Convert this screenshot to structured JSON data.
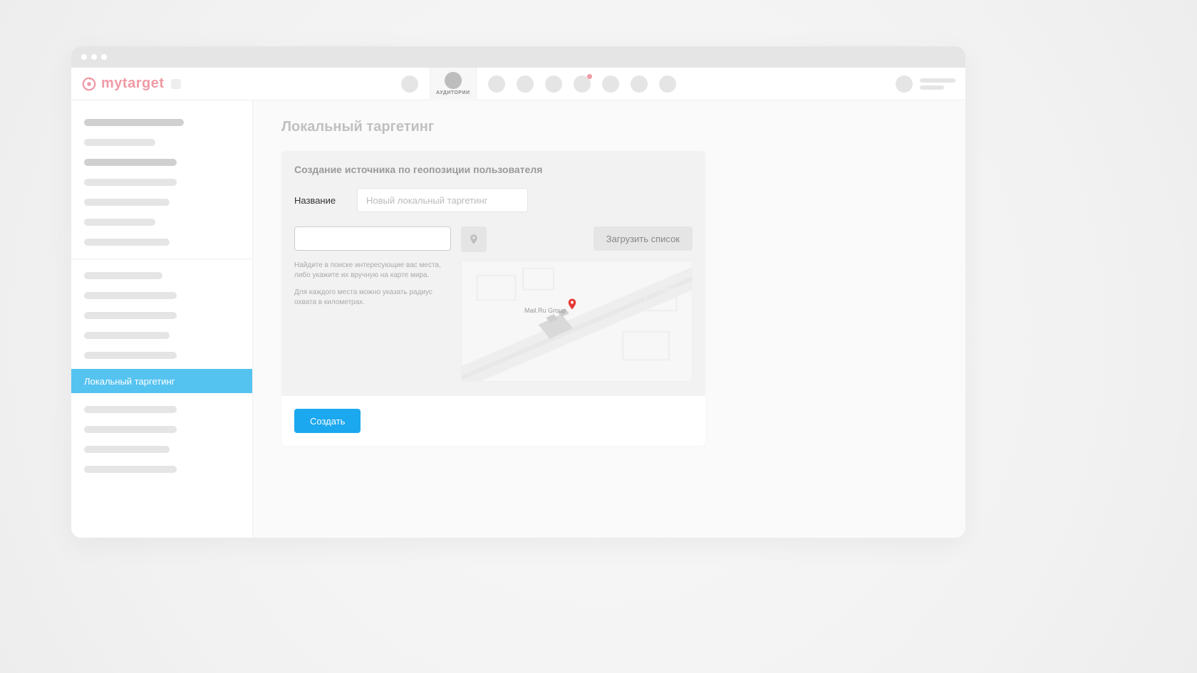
{
  "brand": {
    "name": "mytarget"
  },
  "topnav": {
    "active_tab_label": "АУДИТОРИИ"
  },
  "sidebar": {
    "active_item_label": "Локальный таргетинг"
  },
  "page": {
    "title": "Локальный таргетинг"
  },
  "panel": {
    "subtitle": "Создание источника по геопозиции пользователя",
    "name_label": "Название",
    "name_placeholder": "Новый локальный таргетинг",
    "upload_button": "Загрузить список",
    "help1": "Найдите в поиске интересующие вас места, либо укажите их вручную на карте мира.",
    "help2": "Для каждого места можно указать радиус охвата в километрах.",
    "map_label": "Mail.Ru Group",
    "create_button": "Создать"
  }
}
